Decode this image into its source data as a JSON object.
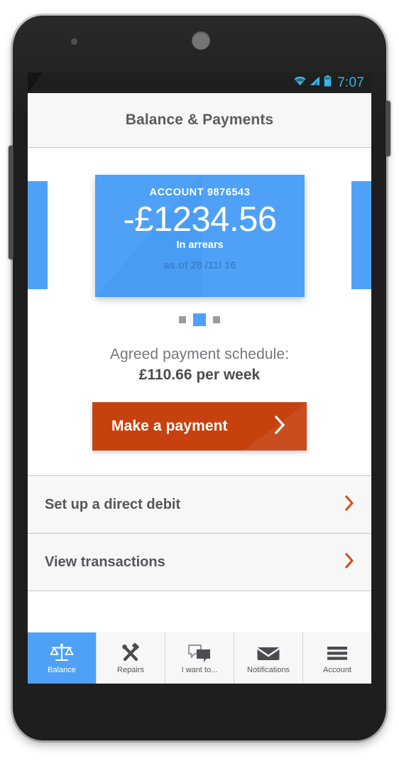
{
  "status_bar": {
    "clock": "7:07",
    "icons": [
      "wifi-icon",
      "signal-icon",
      "battery-icon"
    ]
  },
  "header": {
    "title": "Balance & Payments"
  },
  "balance_card": {
    "account_label": "ACCOUNT 9876543",
    "amount": "-£1234.56",
    "status": "In arrears",
    "as_of": "as of 28 /11/ 16",
    "card_color": "#4ea1f7",
    "peek_cards": 2
  },
  "pager": {
    "total": 3,
    "active_index": 1
  },
  "schedule": {
    "line1": "Agreed payment schedule:",
    "line2": "£110.66 per week"
  },
  "cta": {
    "label": "Make a payment",
    "chevron": "chevron-right-icon",
    "color": "#c7410f"
  },
  "links": [
    {
      "label": "Set up a direct debit",
      "chevron": "chevron-right-icon"
    },
    {
      "label": "View transactions",
      "chevron": "chevron-right-icon"
    }
  ],
  "tabs": [
    {
      "label": "Balance",
      "icon": "scales-icon",
      "active": true
    },
    {
      "label": "Repairs",
      "icon": "tools-icon",
      "active": false
    },
    {
      "label": "I want to...",
      "icon": "speech-bubbles-icon",
      "active": false
    },
    {
      "label": "Notifications",
      "icon": "envelope-icon",
      "active": false
    },
    {
      "label": "Account",
      "icon": "hamburger-icon",
      "active": false
    }
  ],
  "theme": {
    "accent_blue": "#4ea1f7",
    "accent_orange": "#c7410f",
    "status_blue": "#33b5e5",
    "text_gray": "#55555a"
  }
}
